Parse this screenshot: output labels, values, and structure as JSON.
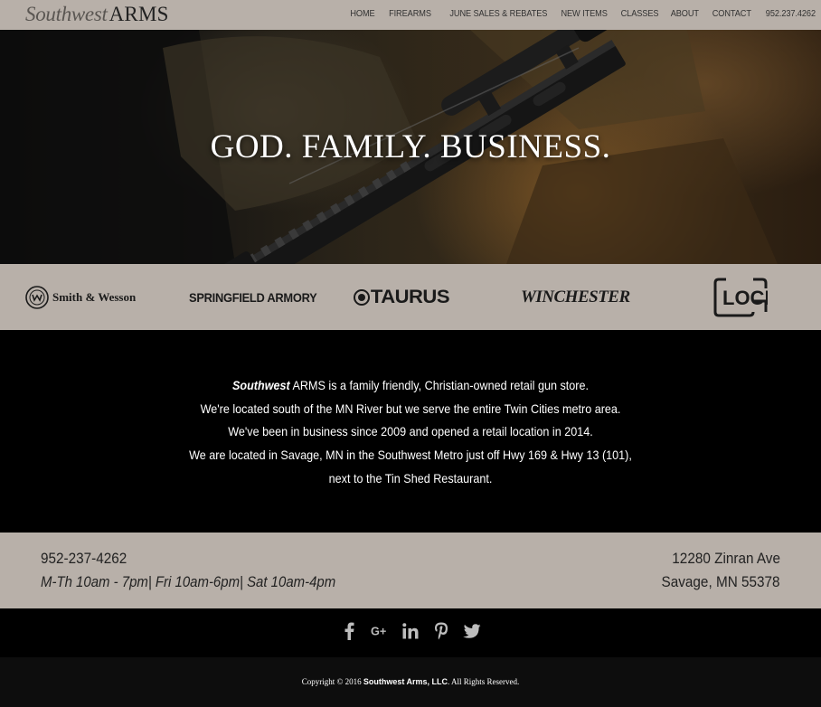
{
  "header": {
    "logo_italic": "Southwest",
    "logo_caps": "ARMS",
    "nav": [
      "HOME",
      "FIREARMS",
      "JUNE SALES & REBATES",
      "NEW ITEMS",
      "CLASSES",
      "ABOUT",
      "CONTACT"
    ],
    "phone": "952.237.4262"
  },
  "hero": {
    "title": "GOD. FAMILY. BUSINESS."
  },
  "brands": {
    "smith_wesson": "Smith & Wesson",
    "springfield": "SPRINGFIELD ARMORY",
    "taurus": "TAURUS",
    "winchester": "WINCHESTER",
    "glock": "GLOCK"
  },
  "about": {
    "line1_italic": "Southwest",
    "line1_rest": " ARMS is a family friendly, Christian-owned retail gun store.",
    "line2": "We're located south of the MN River but we serve the entire Twin Cities metro area.",
    "line3": "We've been in business since 2009 and opened a retail location in 2014.",
    "line4": "We are located in Savage, MN in the Southwest Metro just off Hwy 169 & Hwy 13 (101),",
    "line5": "next to the Tin Shed Restaurant."
  },
  "contact": {
    "phone": "952-237-4262",
    "hours": "M-Th 10am - 7pm| Fri 10am-6pm| Sat 10am-4pm",
    "address_line1": "12280 Zinran Ave",
    "address_line2": "Savage, MN 55378"
  },
  "social": {
    "icons": [
      "facebook-icon",
      "google-plus-icon",
      "linkedin-icon",
      "pinterest-icon",
      "twitter-icon"
    ],
    "color": "#bdbdbd"
  },
  "footer": {
    "copy_prefix": "Copyright © 2016 ",
    "company": "Southwest Arms, LLC",
    "copy_suffix": ". All Rights Reserved."
  },
  "colors": {
    "band": "#b8b0a9",
    "dark": "#000000",
    "footer": "#0d0d0d"
  }
}
